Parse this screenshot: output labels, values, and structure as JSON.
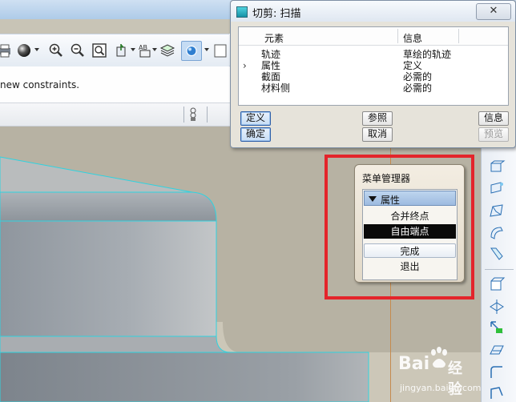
{
  "message": {
    "text": "new constraints."
  },
  "dialog": {
    "title": "切剪: 扫描",
    "close_label": "✕",
    "columns": {
      "element": "元素",
      "info": "信息"
    },
    "rows": [
      {
        "marker": "",
        "element": "轨迹",
        "info": "草绘的轨迹"
      },
      {
        "marker": "›",
        "element": "属性",
        "info": "定义"
      },
      {
        "marker": "",
        "element": "截面",
        "info": "必需的"
      },
      {
        "marker": "",
        "element": "材料侧",
        "info": "必需的"
      }
    ],
    "buttons": {
      "define": "定义",
      "reference": "参照",
      "info": "信息",
      "ok": "确定",
      "cancel": "取消",
      "preview": "预览"
    }
  },
  "menu_manager": {
    "title": "菜单管理器",
    "section": "属性",
    "items": [
      "合并终点",
      "自由端点"
    ],
    "selected_item": "自由端点",
    "done": "完成",
    "exit": "退出"
  },
  "watermark": {
    "brand": "Bai",
    "brand_cn": "经验",
    "url": "jingyan.baidu.com"
  },
  "colors": {
    "highlight_box": "#e3242b",
    "viewport_bg": "#b7b2a3",
    "model_edge": "#2fd3e0",
    "selected_bg": "#0a0a0a"
  },
  "icons": [
    "printer-icon",
    "sphere-shading-icon",
    "zoom-in-icon",
    "zoom-out-icon",
    "zoom-fit-icon",
    "reorient-icon",
    "named-view-icon",
    "layers-icon",
    "display-style-icon"
  ]
}
